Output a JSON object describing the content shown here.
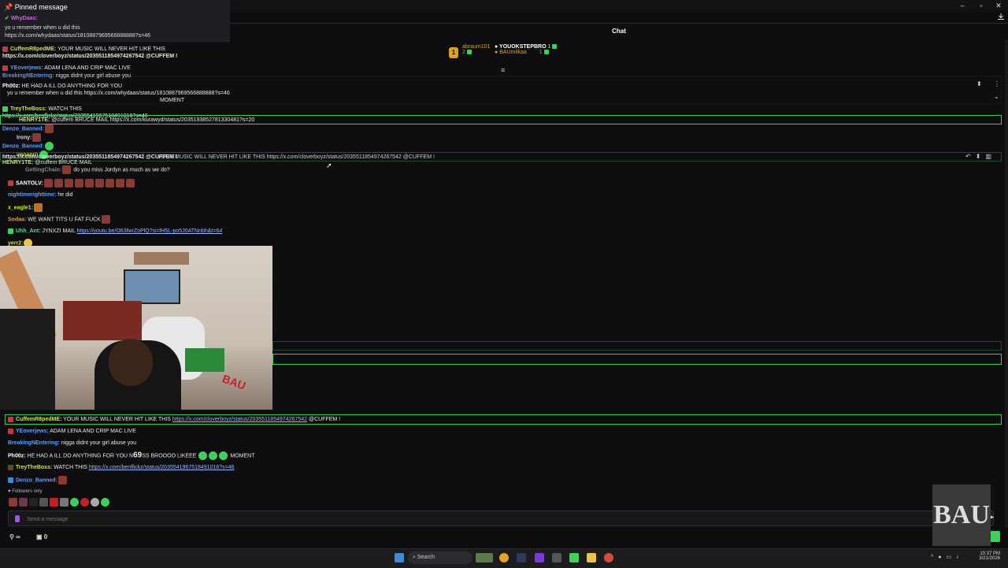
{
  "window": {
    "controls": [
      "–",
      "▫",
      "✕"
    ],
    "download_icon": "download-icon"
  },
  "pinned": {
    "title": "Pinned message",
    "user": "WhyDaas:",
    "text": "yo u remember when u did this",
    "link": "https://x.com/whydaas/status/1810887969566888888?s=46"
  },
  "chat": {
    "header": "Chat",
    "leaderboard": {
      "first": {
        "rank": "1",
        "name": "abraum101",
        "value": "2"
      },
      "mid": [
        {
          "name": "YOUOKSTEPBRO",
          "value": "1"
        },
        {
          "name": "BAUmilkaa",
          "value": "1"
        }
      ]
    },
    "overlay_lines": [
      {
        "user": "CuffemR8pedME:",
        "text": "YOUR MUSIC WILL NEVER HIT LIKE THIS"
      },
      {
        "user": "",
        "text": "https://x.com/cloverboyz/status/2035511854974267542 @CUFFEM !"
      },
      {
        "user": "YEoverjews:",
        "text": "ADAM LENA AND CRIP MAC LIVE"
      },
      {
        "user": "BreakingNEntering:",
        "text": "nigga didnt your girl abuse you"
      },
      {
        "user": "Ph00z:",
        "text": "HE HAD A ILL DO ANYTHING FOR YOU"
      },
      {
        "user": "",
        "text": "yo u remember when u did this https://x.com/whydaas/status/1810887969566888888?s=46"
      },
      {
        "user": "",
        "text": "MOMENT"
      },
      {
        "user": "TreyTheBoss:",
        "text": "WATCH THIS"
      },
      {
        "user": "",
        "text": "https://x.com/benflickz/status/2035541967518491016?s=46"
      },
      {
        "user": "HENRY1TE:",
        "text": "@cuffem BRUCE MAIL https://x.com/kurawyd/status/2035193852781330481?s=20"
      },
      {
        "user": "Denzo_Banned:",
        "text": ""
      },
      {
        "user": "Irony:",
        "text": ""
      },
      {
        "user": "Denzo_Banned:",
        "text": ""
      },
      {
        "user": "vooanri:",
        "text": ""
      },
      {
        "user": "HENRY1TE:",
        "text": "@cuffem BRUCE MAIL"
      },
      {
        "user": "",
        "text": "https://x.com/cloverboyz/status/2035511854974267542 @CUFFEM !"
      }
    ],
    "highlighted_reply": "YOUR MUSIC WILL NEVER HIT LIKE THIS https://x.com/cloverboyz/status/2035511854974267542 @CUFFEM !",
    "mid_lines": [
      {
        "user": "GettingChain:",
        "text": "do you miss Jordyn as much as we do?"
      },
      {
        "user": "SANTOLV:",
        "text": ""
      },
      {
        "user": "nightimerighttime:",
        "text": "he did"
      },
      {
        "user": "x_eagle1:",
        "text": ""
      },
      {
        "user": "Sodaa:",
        "text": "WE WANT TITS U FAT FUCK"
      },
      {
        "user": "Uhh_Ant:",
        "text": "JYNXZI MAIL",
        "link": "https://youtu.be/O63fwrZoPlQ?si=lH5L-po5J0ATNnbh&t=64"
      },
      {
        "user": "yerr2:",
        "text": ""
      }
    ],
    "bottom_lines": [
      {
        "user": "CuffemR8pedME:",
        "text": "YOUR MUSIC WILL NEVER HIT LIKE THIS",
        "link": "https://x.com/cloverboyz/status/2035511854974267542",
        "after": "@CUFFEM !"
      },
      {
        "user": "YEoverjews:",
        "text": "ADAM LENA AND CRIP MAC LIVE"
      },
      {
        "user": "BreakingNEntering:",
        "text": "nigga didnt your girl abuse you"
      },
      {
        "user": "Ph00z:",
        "text": "HE HAD A ILL DO ANYTHING FOR YOU N",
        "num": "69",
        "after": "SS BROOOO LIKEEE",
        "tail": "MOMENT"
      },
      {
        "user": "TreyTheBoss:",
        "text": "WATCH THIS",
        "link": "https://x.com/benflickz/status/2035541967518491016?s=46"
      },
      {
        "user": "Denzo_Banned:",
        "text": ""
      }
    ],
    "followers_only": "Followers only",
    "send_placeholder": "Send a message",
    "footer": {
      "infinity": "∞",
      "count": "0"
    }
  },
  "taskbar": {
    "search": "Search",
    "time": "10:37 PM",
    "date": "3/21/2026"
  },
  "webcam_logo": "BAU",
  "colors": {
    "accent_green": "#3bd15a",
    "link_blue": "#9bb8ff",
    "bg": "#0e0e10"
  }
}
